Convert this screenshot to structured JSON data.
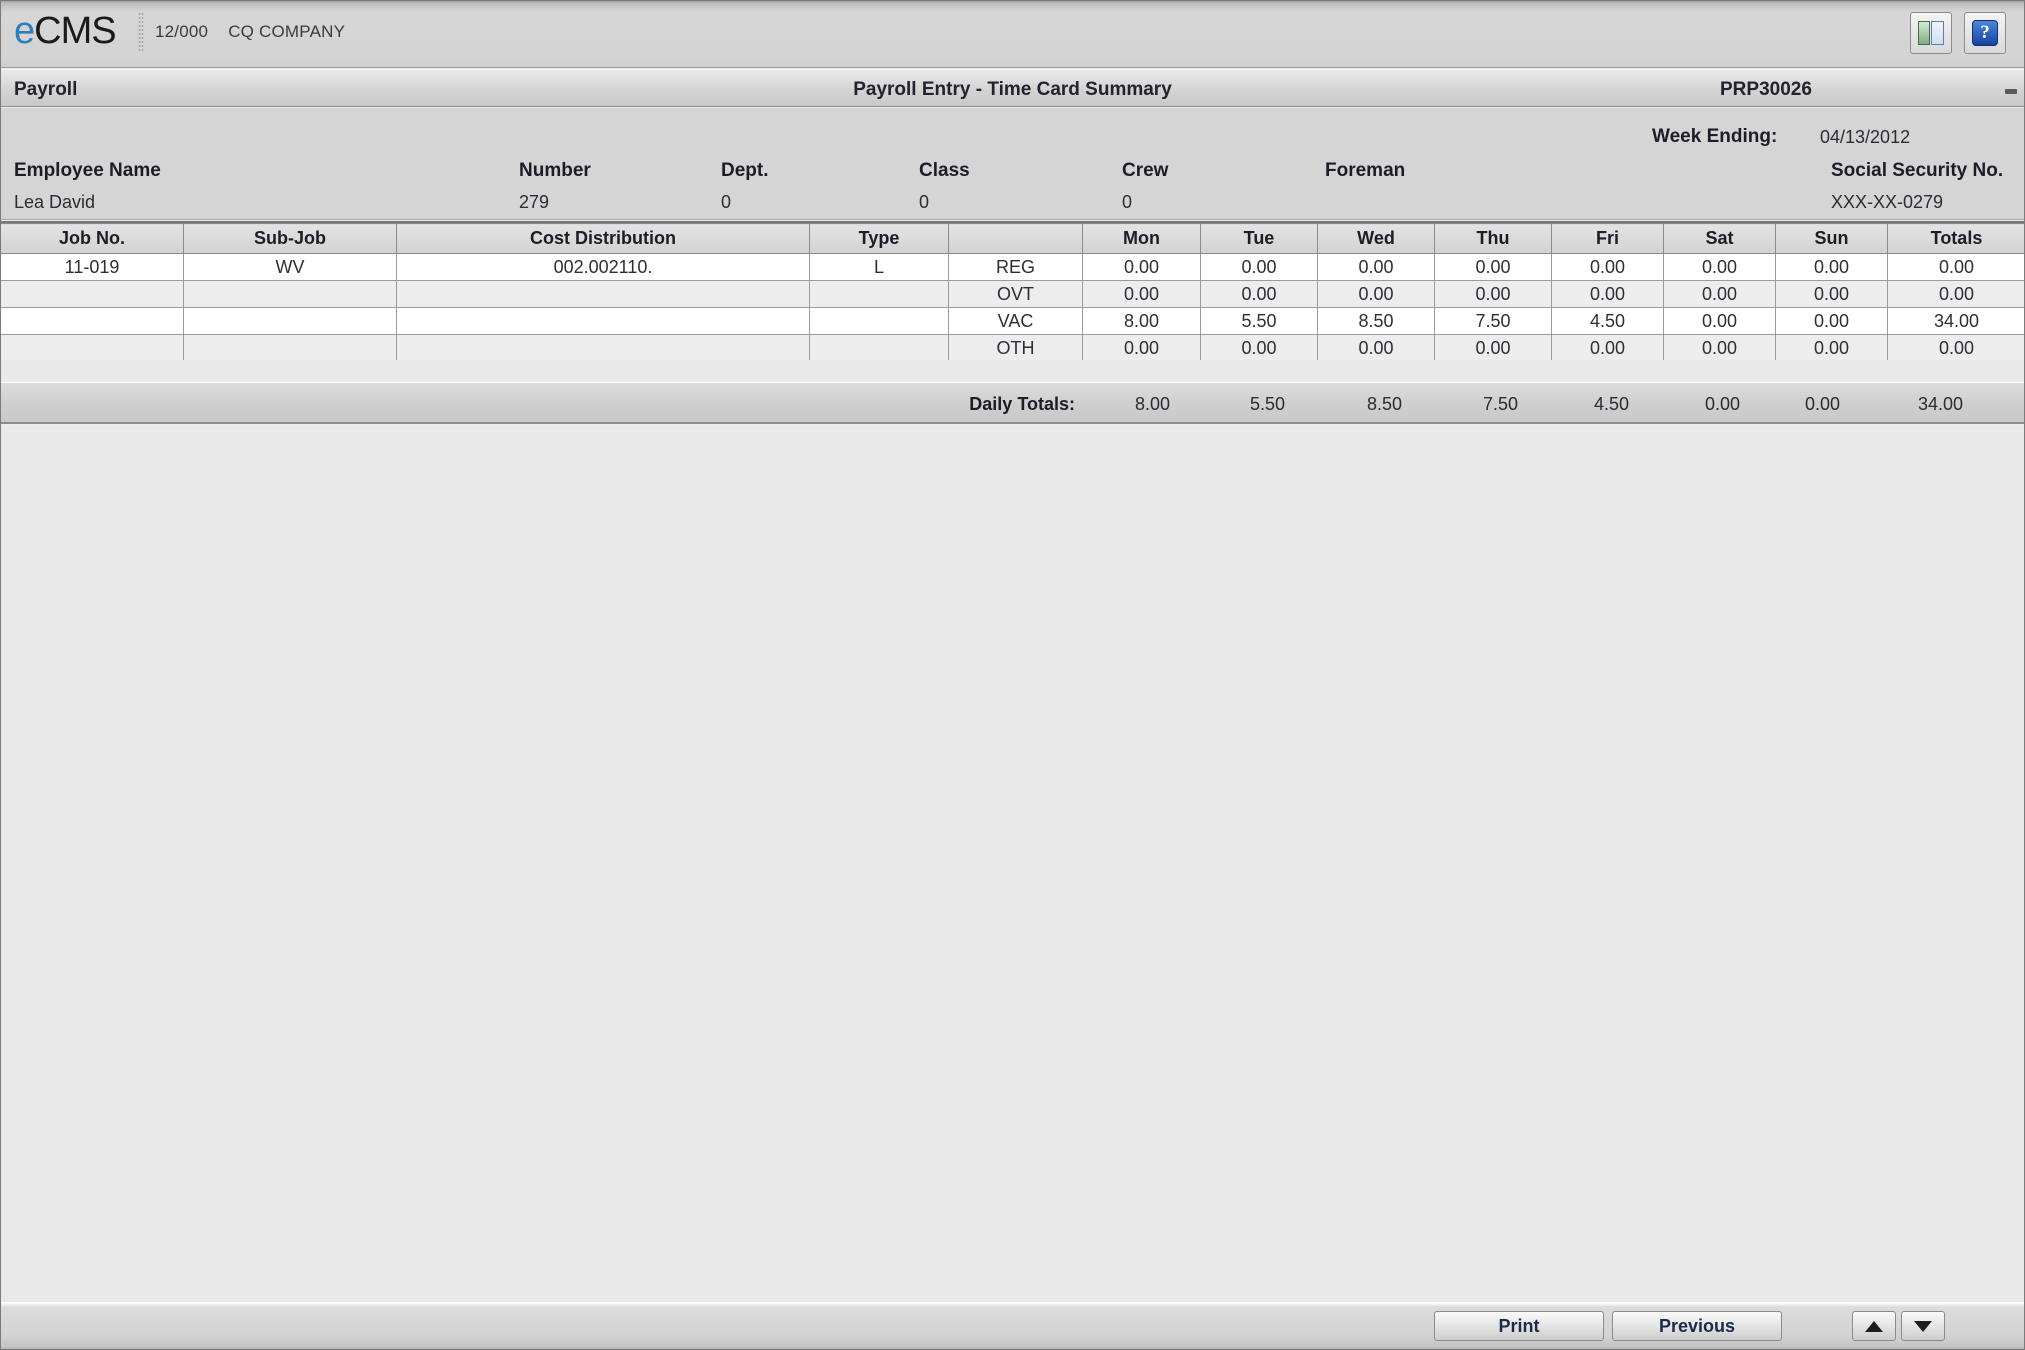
{
  "appbar": {
    "logo_e": "e",
    "logo_rest": "CMS",
    "company_code": "12/000",
    "company_name": "CQ COMPANY",
    "window_button_icon": "split-window-icon",
    "help_button_icon": "question-mark-icon",
    "help_glyph": "?"
  },
  "titlebar": {
    "module": "Payroll",
    "screen_title": "Payroll Entry - Time Card Summary",
    "program_id": "PRP30026",
    "minimize_glyph": "-"
  },
  "header": {
    "week_ending_label": "Week Ending:",
    "week_ending_value": "04/13/2012",
    "employee_name_label": "Employee Name",
    "employee_name_value": "Lea David",
    "number_label": "Number",
    "number_value": "279",
    "dept_label": "Dept.",
    "dept_value": "0",
    "class_label": "Class",
    "class_value": "0",
    "crew_label": "Crew",
    "crew_value": "0",
    "foreman_label": "Foreman",
    "foreman_value": "",
    "ssn_label": "Social Security No.",
    "ssn_value": "XXX-XX-0279"
  },
  "grid": {
    "columns": [
      "Job No.",
      "Sub-Job",
      "Cost Distribution",
      "Type",
      "",
      "Mon",
      "Tue",
      "Wed",
      "Thu",
      "Fri",
      "Sat",
      "Sun",
      "Totals"
    ],
    "rows": [
      {
        "job_no": "11-019",
        "sub_job": "WV",
        "cost_distribution": "002.002110.",
        "type": "L",
        "category": "REG",
        "mon": "0.00",
        "tue": "0.00",
        "wed": "0.00",
        "thu": "0.00",
        "fri": "0.00",
        "sat": "0.00",
        "sun": "0.00",
        "totals": "0.00"
      },
      {
        "job_no": "",
        "sub_job": "",
        "cost_distribution": "",
        "type": "",
        "category": "OVT",
        "mon": "0.00",
        "tue": "0.00",
        "wed": "0.00",
        "thu": "0.00",
        "fri": "0.00",
        "sat": "0.00",
        "sun": "0.00",
        "totals": "0.00"
      },
      {
        "job_no": "",
        "sub_job": "",
        "cost_distribution": "",
        "type": "",
        "category": "VAC",
        "mon": "8.00",
        "tue": "5.50",
        "wed": "8.50",
        "thu": "7.50",
        "fri": "4.50",
        "sat": "0.00",
        "sun": "0.00",
        "totals": "34.00"
      },
      {
        "job_no": "",
        "sub_job": "",
        "cost_distribution": "",
        "type": "",
        "category": "OTH",
        "mon": "0.00",
        "tue": "0.00",
        "wed": "0.00",
        "thu": "0.00",
        "fri": "0.00",
        "sat": "0.00",
        "sun": "0.00",
        "totals": "0.00"
      }
    ]
  },
  "daily_totals": {
    "label": "Daily Totals:",
    "mon": "8.00",
    "tue": "5.50",
    "wed": "8.50",
    "thu": "7.50",
    "fri": "4.50",
    "sat": "0.00",
    "sun": "0.00",
    "totals": "34.00"
  },
  "footer": {
    "print_label": "Print",
    "previous_label": "Previous",
    "scroll_up_icon": "triangle-up-icon",
    "scroll_down_icon": "triangle-down-icon"
  },
  "colors": {
    "accent_blue": "#2c7fb8",
    "button_text": "#1c2b4a",
    "panel_gray": "#d5d5d5",
    "canvas_gray": "#e9e9e9"
  }
}
